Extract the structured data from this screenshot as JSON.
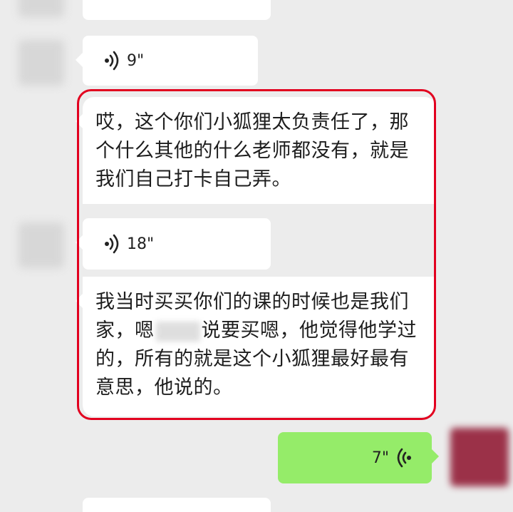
{
  "messages": [
    {
      "type": "voice",
      "side": "left",
      "duration": "9\""
    },
    {
      "type": "text",
      "side": "left",
      "text": "哎，这个你们小狐狸太负责任了，那个什么其他的什么老师都没有，就是我们自己打卡自己弄。"
    },
    {
      "type": "voice",
      "side": "left",
      "duration": "18\""
    },
    {
      "type": "text",
      "side": "left",
      "text_before": "我当时买买你们的课的时候也是我们家，嗯",
      "text_after": "说要买嗯，他觉得他学过的，所有的就是这个小狐狸最好最有意思，他说的。"
    },
    {
      "type": "voice",
      "side": "right",
      "duration": "7\""
    }
  ],
  "colors": {
    "background": "#ececec",
    "incoming_bubble": "#ffffff",
    "outgoing_bubble": "#95ec69",
    "highlight_border": "#e2001f"
  },
  "icons": {
    "voice_incoming": "voice-wave-right-icon",
    "voice_outgoing": "voice-wave-left-icon"
  }
}
